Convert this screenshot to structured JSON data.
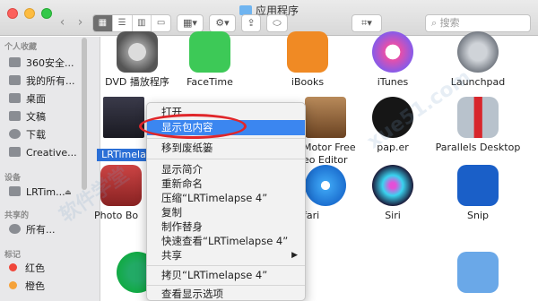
{
  "window": {
    "title": "应用程序",
    "search_placeholder": "搜索"
  },
  "sidebar": {
    "favorites_header": "个人收藏",
    "favorites": [
      {
        "label": "360安全..."
      },
      {
        "label": "我的所有..."
      },
      {
        "label": "桌面"
      },
      {
        "label": "文稿"
      },
      {
        "label": "下载"
      },
      {
        "label": "Creative..."
      }
    ],
    "devices_header": "设备",
    "devices": [
      {
        "label": "LRTim..."
      }
    ],
    "shared_header": "共享的",
    "shared": [
      {
        "label": "所有..."
      }
    ],
    "tags_header": "标记",
    "tags": [
      {
        "label": "红色",
        "color": "#f0463a"
      },
      {
        "label": "橙色",
        "color": "#f5a23a"
      }
    ]
  },
  "apps": [
    {
      "label": "DVD 播放程序"
    },
    {
      "label": "FaceTime"
    },
    {
      "label": "iBooks"
    },
    {
      "label": "iTunes"
    },
    {
      "label": "Launchpad"
    },
    {
      "label": "LRTimela"
    },
    {
      "label": "Motor Free"
    },
    {
      "label": "eo Editor"
    },
    {
      "label": "pap.er"
    },
    {
      "label": "Parallels Desktop"
    },
    {
      "label": "Photo Bo"
    },
    {
      "label": "fari"
    },
    {
      "label": "Siri"
    },
    {
      "label": "Snip"
    }
  ],
  "context_menu": {
    "items": [
      {
        "label": "打开"
      },
      {
        "label": "显示包内容"
      },
      {
        "label": "移到废纸篓"
      },
      {
        "label": "显示简介"
      },
      {
        "label": "重新命名"
      },
      {
        "label": "压缩“LRTimelapse 4”"
      },
      {
        "label": "复制"
      },
      {
        "label": "制作替身"
      },
      {
        "label": "快速查看“LRTimelapse 4”"
      },
      {
        "label": "共享"
      },
      {
        "label": "拷贝“LRTimelapse 4”"
      },
      {
        "label": "查看显示选项"
      }
    ],
    "submenu_arrow": "▶"
  },
  "colors": {
    "highlight": "#3b86f0",
    "annotation": "#e0262a"
  },
  "icons": {
    "back": "‹",
    "forward": "›",
    "gear": "⚙",
    "tag": "⬭",
    "share": "⇪"
  }
}
